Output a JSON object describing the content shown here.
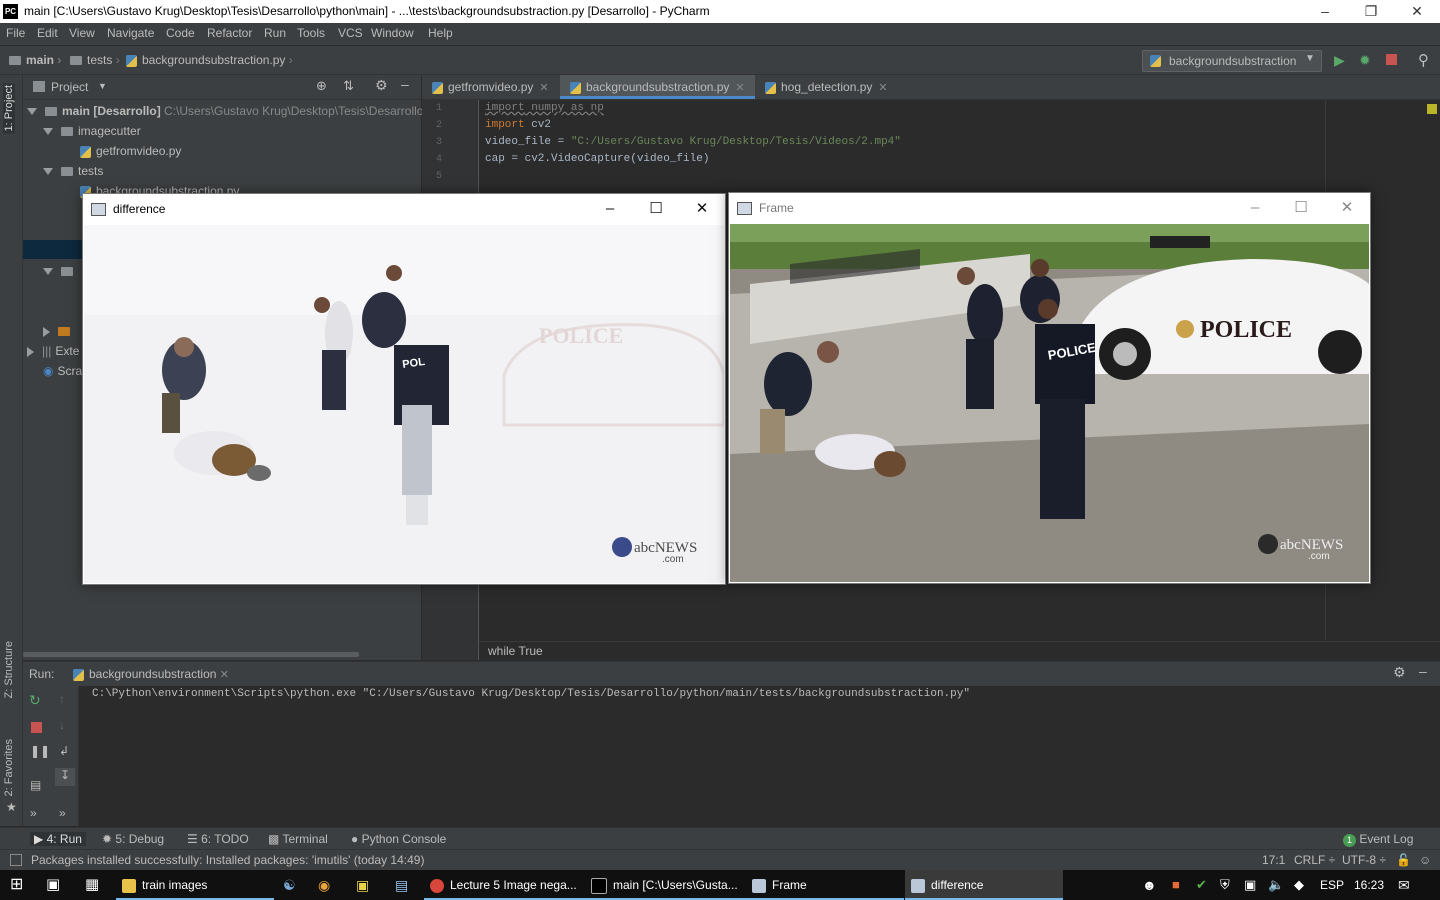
{
  "window": {
    "title": "main [C:\\Users\\Gustavo Krug\\Desktop\\Tesis\\Desarrollo\\python\\main] - ...\\tests\\backgroundsubstraction.py [Desarrollo] - PyCharm",
    "logo": "PC"
  },
  "menu": [
    "File",
    "Edit",
    "View",
    "Navigate",
    "Code",
    "Refactor",
    "Run",
    "Tools",
    "VCS",
    "Window",
    "Help"
  ],
  "breadcrumb": [
    "main",
    "tests",
    "backgroundsubstraction.py"
  ],
  "run_config": "backgroundsubstraction",
  "left_stripe": {
    "project": "1: Project",
    "structure": "Z: Structure",
    "favorites": "2: Favorites"
  },
  "project_panel": {
    "title": "Project",
    "tree": {
      "root_name": "main [Desarrollo]",
      "root_path": "C:\\Users\\Gustavo Krug\\Desktop\\Tesis\\Desarrollo\\",
      "imagecutter": "imagecutter",
      "getfromvideo": "getfromvideo.py",
      "tests": "tests",
      "bgsub": "backgroundsubstraction.py",
      "ext": "Exte",
      "scratch": "Scra"
    }
  },
  "editor": {
    "tabs": [
      "getfromvideo.py",
      "backgroundsubstraction.py",
      "hog_detection.py"
    ],
    "line_numbers": [
      "1",
      "2",
      "3",
      "4",
      "5"
    ],
    "code": {
      "l1_kw": "import",
      "l1_rest": " numpy as np",
      "l2_kw": "import",
      "l2_rest": " cv2",
      "l3_a": "video_file = ",
      "l3_str": "\"C:/Users/Gustavo Krug/Desktop/Tesis/Videos/2.mp4\"",
      "l4": "cap = cv2.VideoCapture(video_file)"
    },
    "breadcrumb_bottom": "while True"
  },
  "run_panel": {
    "label": "Run:",
    "tab": "backgroundsubstraction",
    "output": "C:\\Python\\environment\\Scripts\\python.exe \"C:/Users/Gustavo Krug/Desktop/Tesis/Desarrollo/python/main/tests/backgroundsubstraction.py\""
  },
  "bottom_tabs": {
    "run": "4: Run",
    "debug": "5: Debug",
    "todo": "6: TODO",
    "terminal": "Terminal",
    "console": "Python Console",
    "eventlog": "Event Log",
    "eventlog_count": "1"
  },
  "status": {
    "message": "Packages installed successfully: Installed packages: 'imutils' (today 14:49)",
    "position": "17:1",
    "line_sep": "CRLF ÷",
    "encoding": "UTF-8 ÷"
  },
  "windows": {
    "difference": {
      "title": "difference",
      "watermark": "abcNEWS",
      "watermark_sub": ".com",
      "overlay_text": "POLICE"
    },
    "frame": {
      "title": "Frame",
      "watermark": "abcNEWS",
      "watermark_sub": ".com",
      "car_text": "POLICE",
      "vest_text": "POLICE"
    }
  },
  "taskbar": {
    "items": [
      "train images",
      "Lecture 5 Image nega...",
      "main [C:\\Users\\Gusta...",
      "Frame",
      "difference"
    ],
    "lang": "ESP",
    "time": "16:23"
  },
  "colors": {
    "accent": "#4a88c7",
    "ide_bg": "#2b2b2b",
    "panel_bg": "#3c3f41",
    "keyword": "#cc7832",
    "string": "#6a8759"
  }
}
